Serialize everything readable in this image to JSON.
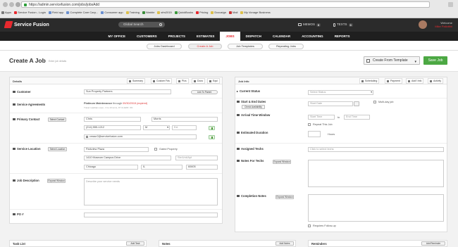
{
  "browser": {
    "url": "https://admin.servicefusion.com/jobs/jobsAdd",
    "bookmarks": [
      "Apps",
      "Service Fusion - Login",
      "Field app",
      "Complete Care Carp...",
      "Consumer app",
      "Training",
      "Nimble",
      "sfm2015",
      "QuickBooks",
      "Pricing",
      "Docusign",
      "Mail",
      "My Vonage Business"
    ]
  },
  "header": {
    "logo_text": "Service Fusion",
    "search_label": "Global Search",
    "memos_label": "MEMOS",
    "memos_count": "0",
    "texts_label": "TEXTS",
    "texts_count": "0",
    "welcome": "Welcome",
    "user_name": "Mike Pallottini"
  },
  "nav": [
    "MY OFFICE",
    "CUSTOMERS",
    "PROJECTS",
    "ESTIMATES",
    "JOBS",
    "DISPATCH",
    "CALENDAR",
    "ACCOUNTING",
    "REPORTS"
  ],
  "subnav": [
    "Jobs Dashboard",
    "Create A Job",
    "Job Templates",
    "Repeating Jobs"
  ],
  "page": {
    "title": "Create A Job",
    "subtitle": "Enter job details",
    "create_from_template": "Create From Template",
    "save_job": "Save Job"
  },
  "details": {
    "title": "Details",
    "tabs": [
      "Summary",
      "Custom Fds",
      "Pics",
      "Docs",
      "Equi"
    ],
    "customer_label": "Customer",
    "customer_value": "Sun Property Partners",
    "link_to_parent": "Link To Parent",
    "service_agreements_label": "Service Agreements",
    "agreement_name": "Platinum Maintenance",
    "agreement_through": "through",
    "agreement_date": "09/30/2015 (expired)",
    "agreement_terms": "Travel roadtrips uses - 0 to 10 turns, 97 CLIENT, 0%",
    "primary_contact_label": "Primary Contact",
    "select_contact": "Select Contact",
    "first_name": "Chris",
    "last_name": "Morris",
    "phone": "(214) 555-1212",
    "phone_type": "M",
    "ext_placeholder": "Ext",
    "email": "cmaur2@servicefusion.com",
    "service_location_label": "Service Location",
    "select_location": "Select Location",
    "location_name": "Parkview Plaza",
    "gated_property": "Gated Property",
    "address": "1410 Museum Campus Drive",
    "unit_placeholder": "Ste/Unit/Apt",
    "city": "Chicago",
    "state": "IL",
    "zip": "60605",
    "job_description_label": "Job Description",
    "expand_window": "Expand Window",
    "job_description_placeholder": "Describe your service needs",
    "po_label": "PO #"
  },
  "jobinfo": {
    "title": "Job Info",
    "tabs": [
      "Scheduling",
      "Payment",
      "Add'l Info",
      "Activity"
    ],
    "current_status_label": "Current Status",
    "select_status": "Select Status",
    "start_end_label": "Start & End Dates",
    "check_availability": "Check Availability",
    "start_date": "Start Date",
    "multiday": "Multi-day job",
    "arrival_label": "Arrival Time Window",
    "start_time": "Start Time",
    "to": "to",
    "end_time": "End Time",
    "repeat": "Repeat This Job",
    "duration_label": "Estimated Duration",
    "hours": "Hours",
    "techs_label": "Assigned Techs",
    "techs_placeholder": "Click to select techs",
    "notes_label": "Notes For Techs",
    "completion_label": "Completion Notes",
    "requires_followup": "Requires Follow-up"
  },
  "bottom": {
    "task_list": "Task List",
    "add_task": "Add Task",
    "notes": "Notes",
    "add_note": "Add Notes",
    "reminders": "Reminders",
    "add_reminder": "Add Reminder"
  },
  "colors": {
    "brand": "#e8292e",
    "save": "#4ca843",
    "topbar": "#2b2b2b"
  }
}
